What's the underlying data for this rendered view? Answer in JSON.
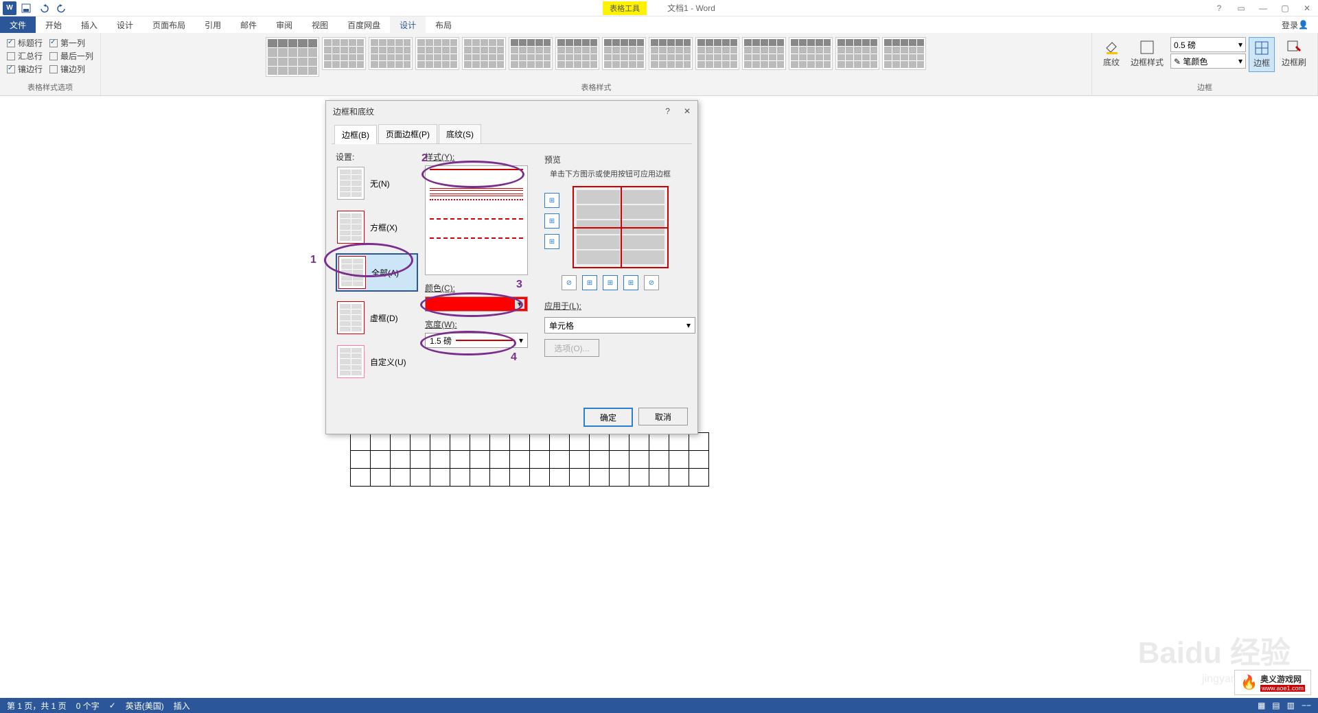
{
  "app": {
    "context_tab": "表格工具",
    "doc_title": "文档1 - Word"
  },
  "qat": {
    "save": "保存",
    "undo": "撤销",
    "redo": "重做"
  },
  "tabs": {
    "file": "文件",
    "home": "开始",
    "insert": "插入",
    "design_main": "设计",
    "layout": "页面布局",
    "references": "引用",
    "mailings": "邮件",
    "review": "审阅",
    "view": "视图",
    "baidu": "百度网盘",
    "tbl_design": "设计",
    "tbl_layout": "布局",
    "signin": "登录"
  },
  "ribbon": {
    "options_group": "表格样式选项",
    "opts": {
      "header_row": "标题行",
      "first_col": "第一列",
      "total_row": "汇总行",
      "last_col": "最后一列",
      "banded_row": "镶边行",
      "banded_col": "镶边列"
    },
    "styles_group": "表格样式",
    "borders_group": "边框",
    "shading": "底纹",
    "border_style": "边框样式",
    "pen_weight": "0.5 磅",
    "pen_color": "笔颜色",
    "borders_btn": "边框",
    "border_painter": "边框刷"
  },
  "dialog": {
    "title": "边框和底纹",
    "tabs": {
      "border": "边框(B)",
      "page_border": "页面边框(P)",
      "shading": "底纹(S)"
    },
    "setting_label": "设置:",
    "settings": {
      "none": "无(N)",
      "box": "方框(X)",
      "all": "全部(A)",
      "grid": "虚框(D)",
      "custom": "自定义(U)"
    },
    "style_label": "样式(Y):",
    "color_label": "颜色(C):",
    "width_label": "宽度(W):",
    "width_value": "1.5 磅",
    "preview_label": "预览",
    "preview_hint": "单击下方图示或使用按钮可应用边框",
    "apply_label": "应用于(L):",
    "apply_value": "单元格",
    "options_btn": "选项(O)...",
    "ok": "确定",
    "cancel": "取消"
  },
  "annotations": {
    "n1": "1",
    "n2": "2",
    "n3": "3",
    "n4": "4"
  },
  "statusbar": {
    "page": "第 1 页，共 1 页",
    "words": "0 个字",
    "lang": "英语(美国)",
    "mode": "插入"
  },
  "watermark": {
    "main": "Baidu 经验",
    "sub": "jingyan.baidu.com"
  },
  "corner": {
    "text": "奥义游戏网",
    "url": "www.aoe1.com"
  }
}
